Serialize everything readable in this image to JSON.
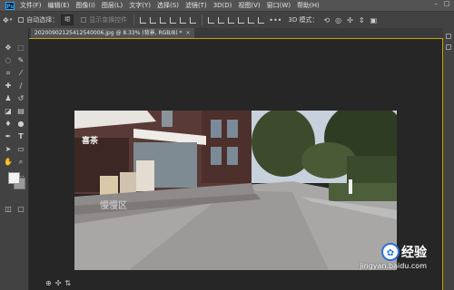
{
  "app": {
    "logo": "Ps"
  },
  "menubar": {
    "items": [
      "文件(F)",
      "编辑(E)",
      "图像(I)",
      "图层(L)",
      "文字(Y)",
      "选择(S)",
      "滤镜(T)",
      "3D(D)",
      "视图(V)",
      "窗口(W)",
      "帮助(H)"
    ],
    "window_controls": [
      "–",
      "□"
    ]
  },
  "options_bar": {
    "auto_select_label": "自动选择：",
    "auto_select_value": "组",
    "show_transform_label": "显示变换控件",
    "mode_label": "3D 模式："
  },
  "document": {
    "tab_title": "20200902125412540006.jpg @ 8.33% (背景, RGB/8) *",
    "close": "×"
  },
  "photo": {
    "sign_text": "喜茶",
    "ground_text": "慢慢区"
  },
  "watermark": {
    "brand": "经验",
    "url": "jingyan.baidu.com",
    "logo_char": "Bai"
  },
  "colors": {
    "menubar_bg": "#535353",
    "panel_bg": "#424242",
    "canvas_bg": "#262626",
    "frame_accent": "#c9a500"
  }
}
